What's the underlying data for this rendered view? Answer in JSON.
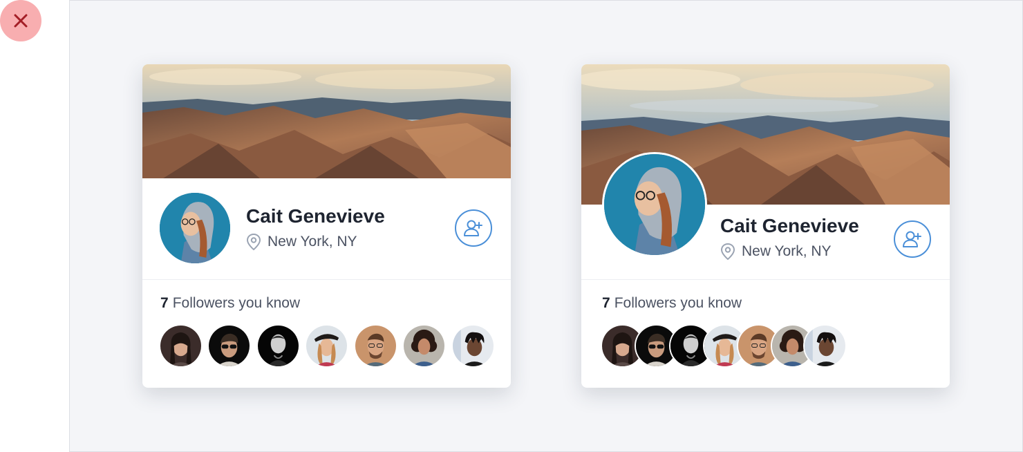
{
  "close_button": {
    "icon": "close-icon",
    "color": "#a31e26"
  },
  "cards": [
    {
      "variant": "compact",
      "name": "Cait Genevieve",
      "location": "New York, NY",
      "followers_count": "7",
      "followers_label": "Followers you know",
      "follow_icon": "add-user-icon"
    },
    {
      "variant": "overlap",
      "name": "Cait Genevieve",
      "location": "New York, NY",
      "followers_count": "7",
      "followers_label": "Followers you know",
      "follow_icon": "add-user-icon"
    }
  ],
  "colors": {
    "accent": "#4a8fd8",
    "name_text": "#1e2430",
    "secondary_text": "#4b5262",
    "canvas_bg": "#f4f5f8",
    "close_bg": "#f8aeb0"
  }
}
